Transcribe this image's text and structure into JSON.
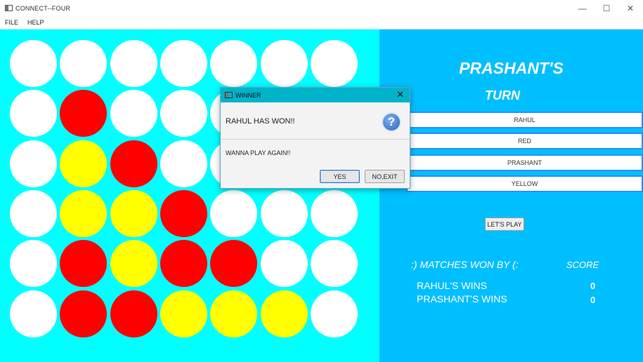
{
  "window": {
    "title": "CONNECT--FOUR",
    "minimize": "—",
    "maximize": "☐",
    "close": "✕"
  },
  "menu": [
    "FILE",
    "HELP"
  ],
  "board": {
    "rows": 6,
    "cols": 7,
    "colors": {
      "empty": "#ffffff",
      "red": "#ff0000",
      "yellow": "#ffff00",
      "background": "#00ffff"
    },
    "cells": [
      [
        "empty",
        "empty",
        "empty",
        "empty",
        "empty",
        "empty",
        "empty"
      ],
      [
        "empty",
        "red",
        "empty",
        "empty",
        "empty",
        "empty",
        "empty"
      ],
      [
        "empty",
        "yellow",
        "red",
        "empty",
        "empty",
        "empty",
        "empty"
      ],
      [
        "empty",
        "yellow",
        "yellow",
        "red",
        "empty",
        "empty",
        "empty"
      ],
      [
        "empty",
        "red",
        "yellow",
        "red",
        "red",
        "empty",
        "empty"
      ],
      [
        "empty",
        "red",
        "red",
        "yellow",
        "yellow",
        "yellow",
        "empty"
      ]
    ]
  },
  "side": {
    "turn_name": "PRASHANT'S",
    "turn_word": "TURN",
    "fields": [
      "RAHUL",
      "RED",
      "PRASHANT",
      "YELLOW"
    ],
    "play_button": "LET'S PLAY",
    "matches_title": ":) MATCHES WON BY (:",
    "score_title": "SCORE",
    "scores": [
      {
        "label": "RAHUL'S WINS",
        "value": "0"
      },
      {
        "label": "PRASHANT'S WINS",
        "value": "0"
      }
    ]
  },
  "dialog": {
    "title": "WINNER",
    "close": "✕",
    "header": "RAHUL HAS WON!!",
    "icon": "question-icon",
    "icon_glyph": "?",
    "content": "WANNA PLAY AGAIN!!",
    "yes": "YES",
    "no": "NO,EXIT"
  }
}
